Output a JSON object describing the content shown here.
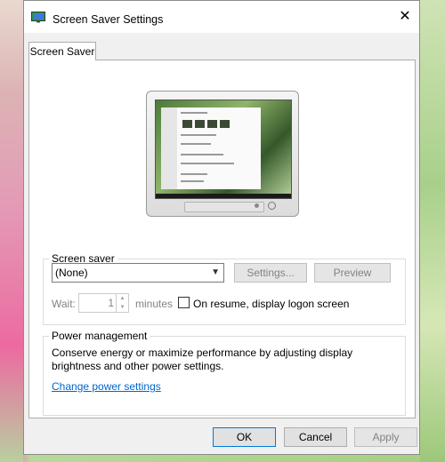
{
  "window": {
    "title": "Screen Saver Settings",
    "close_glyph": "✕"
  },
  "tabs": [
    {
      "label": "Screen Saver"
    }
  ],
  "screen_saver": {
    "group_label": "Screen saver",
    "selected": "(None)",
    "settings_label": "Settings...",
    "preview_label": "Preview",
    "wait_label": "Wait:",
    "wait_value": "1",
    "minutes_label": "minutes",
    "resume_label": "On resume, display logon screen",
    "resume_checked": false
  },
  "power": {
    "group_label": "Power management",
    "description": "Conserve energy or maximize performance by adjusting display brightness and other power settings.",
    "link_label": "Change power settings"
  },
  "footer": {
    "ok_label": "OK",
    "cancel_label": "Cancel",
    "apply_label": "Apply"
  },
  "icons": {
    "title": "display-settings-icon",
    "dropdown": "chevron-down-icon",
    "spin_up": "arrow-up-icon",
    "spin_down": "arrow-down-icon"
  },
  "colors": {
    "link": "#0066cc",
    "default_button_border": "#0078d7",
    "disabled_text": "#838383"
  }
}
